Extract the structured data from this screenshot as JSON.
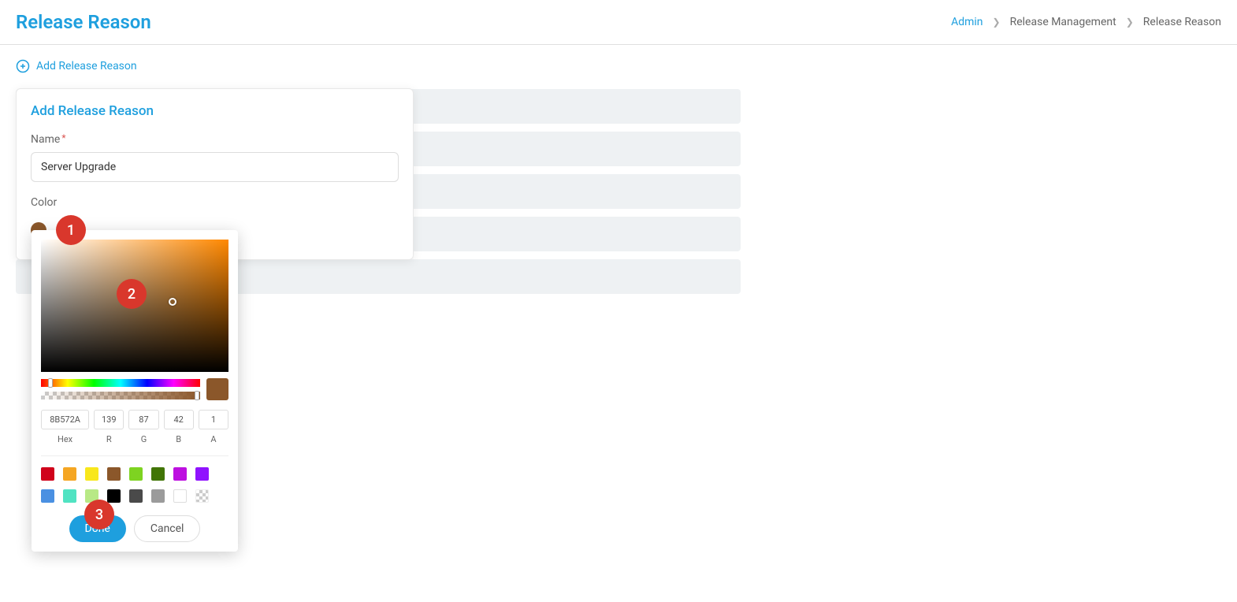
{
  "header": {
    "title": "Release Reason",
    "breadcrumb": {
      "admin": "Admin",
      "middle": "Release Management",
      "current": "Release Reason"
    }
  },
  "actions": {
    "add_link": "Add Release Reason"
  },
  "modal": {
    "title": "Add Release Reason",
    "name_label": "Name",
    "required": "*",
    "name_value": "Server Upgrade",
    "color_label": "Color",
    "selected_color": "#8B572A"
  },
  "picker": {
    "hex": "8B572A",
    "r": "139",
    "g": "87",
    "b": "42",
    "a": "1",
    "labels": {
      "hex": "Hex",
      "r": "R",
      "g": "G",
      "b": "B",
      "a": "A"
    },
    "preview_color": "#8B572A",
    "presets": [
      "#D0021B",
      "#F5A623",
      "#F8E71C",
      "#8B572A",
      "#7ED321",
      "#417505",
      "#BD10E0",
      "#9013FE",
      "#4A90E2",
      "#50E3C2",
      "#B8E986",
      "#000000",
      "#4A4A4A",
      "#9B9B9B"
    ],
    "done_label": "Done",
    "cancel_label": "Cancel"
  },
  "annotations": {
    "one": "1",
    "two": "2",
    "three": "3"
  }
}
